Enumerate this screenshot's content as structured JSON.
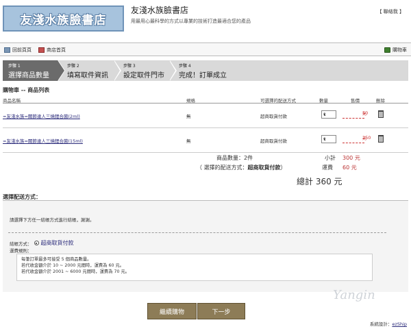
{
  "header": {
    "logo_text": "友淺水族臉書店",
    "shop_title": "友淺水族臉書店",
    "slogan": "用最用心最科學的方式以專業的技術打造最適合您的產品",
    "contact": "【 聯絡我 】"
  },
  "topbar": {
    "back_label": "回前頁頁",
    "home_label": "商店首頁",
    "cart_label": "購物車"
  },
  "steps": [
    {
      "num": "步驟 1",
      "title": "選擇商品數量"
    },
    {
      "num": "步驟 2",
      "title": "填寫取件資訊"
    },
    {
      "num": "步驟 3",
      "title": "設定取件門市"
    },
    {
      "num": "步驟 4",
      "title": "完成！訂單成立"
    }
  ],
  "cart": {
    "section_title": "購物車 -- 商品列表",
    "headers": {
      "name": "商品名稱",
      "spec": "規格",
      "pay": "可選擇的配送方式",
      "qty": "數量",
      "price": "售價",
      "delete": "刪除"
    },
    "rows": [
      {
        "name": "=友淺水族=關節達人三燒鋰合菌(2ml)",
        "spec": "無",
        "pay": "超商取貨付款",
        "qty": "1",
        "price": "50",
        "unit": "元"
      },
      {
        "name": "=友淺水族=關節達人三燒鋰合菌(15ml)",
        "spec": "無",
        "pay": "超商取貨付款",
        "qty": "1",
        "price": "250",
        "unit": "元"
      }
    ]
  },
  "summary": {
    "qty_text": "商品數量：2件",
    "subtotal_label": "小計",
    "subtotal_value": "300 元",
    "ship_method_prefix": "（ 選擇的配送方式：",
    "ship_method_value": "超商取貨付款",
    "ship_method_suffix": "）",
    "shipping_label": "運費",
    "shipping_value": "60 元",
    "total_text": "總計 360 元"
  },
  "shipping": {
    "title": "選擇配送方式：",
    "note": "請選擇下方任一結帳方式進行結帳，謝謝。",
    "method_label": "結帳方式：",
    "method_value": "超商取貨付款",
    "rule_label": "運費規則：",
    "rules": [
      "每筆訂單最多可接受 5 個商品數量。",
      "若代收金額介於 10 ~ 2000 元間時，運費為 60 元。",
      "若代收金額介於 2001 ~ 6000 元間時，運費為 70 元。"
    ]
  },
  "buttons": {
    "continue_label": "繼續購物",
    "next_label": "下一步"
  },
  "footer": {
    "prefix": "系統設計：",
    "link": "ezShip"
  },
  "watermark": "Yangin"
}
